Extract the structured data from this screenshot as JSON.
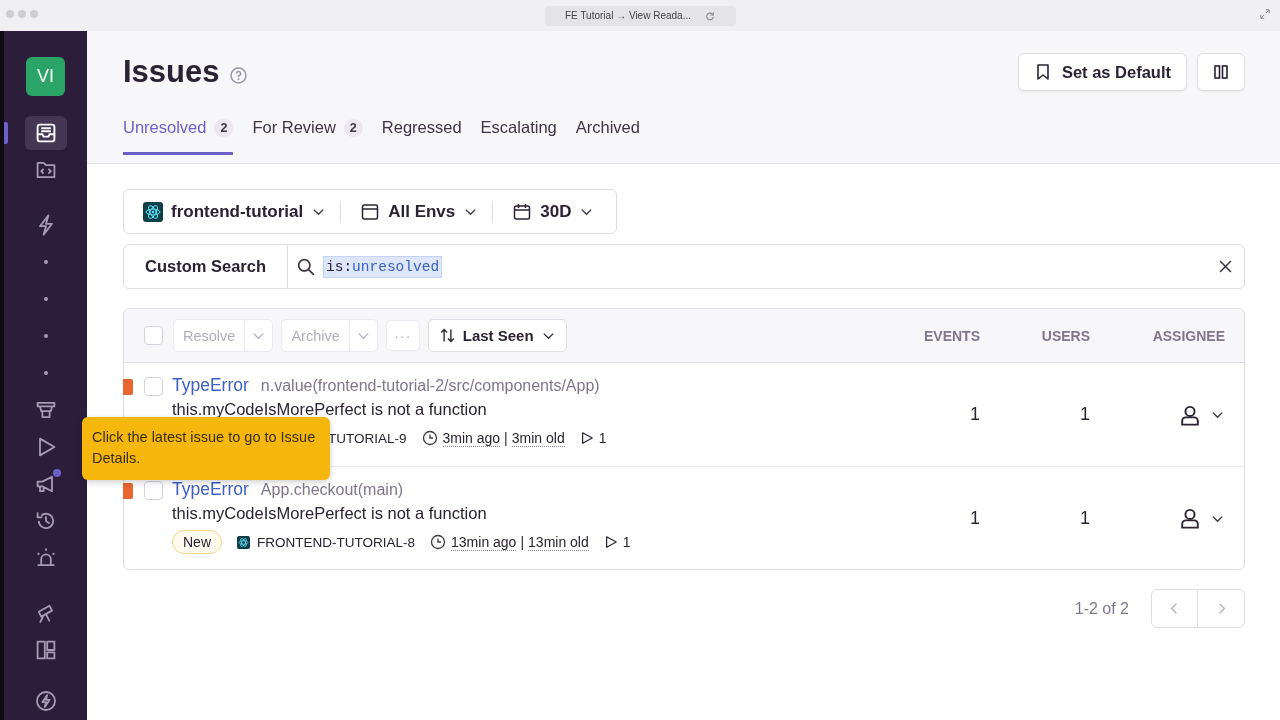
{
  "browser": {
    "title": "FE Tutorial → View Reada..."
  },
  "sidebar": {
    "avatar": "VI",
    "items": [
      {
        "kind": "icon",
        "selected": true,
        "notification": false
      },
      {
        "kind": "icon",
        "selected": false,
        "notification": false
      },
      {
        "kind": "icon",
        "selected": false,
        "notification": false
      },
      {
        "kind": "dot",
        "selected": false,
        "notification": false
      },
      {
        "kind": "dot",
        "selected": false,
        "notification": false
      },
      {
        "kind": "dot",
        "selected": false,
        "notification": false
      },
      {
        "kind": "dot",
        "selected": false,
        "notification": false
      },
      {
        "kind": "icon",
        "selected": false,
        "notification": false
      },
      {
        "kind": "icon",
        "selected": false,
        "notification": false
      },
      {
        "kind": "icon",
        "selected": false,
        "notification": true
      },
      {
        "kind": "icon",
        "selected": false,
        "notification": false
      },
      {
        "kind": "icon",
        "selected": false,
        "notification": false
      },
      {
        "kind": "icon",
        "selected": false,
        "notification": false
      },
      {
        "kind": "icon",
        "selected": false,
        "notification": false
      },
      {
        "kind": "icon",
        "selected": false,
        "notification": false
      }
    ]
  },
  "page": {
    "title": "Issues",
    "buttons": [
      "Set as Default"
    ]
  },
  "tabs": [
    {
      "label": "Unresolved",
      "count": "2",
      "selected": true
    },
    {
      "label": "For Review",
      "count": "2",
      "selected": false
    },
    {
      "label": "Regressed",
      "selected": false
    },
    {
      "label": "Escalating",
      "selected": false
    },
    {
      "label": "Archived",
      "selected": false
    }
  ],
  "filters": {
    "project": "frontend-tutorial",
    "environment": "All Envs",
    "period": "30D"
  },
  "search": {
    "label": "Custom Search",
    "key": "is:",
    "value": "unresolved"
  },
  "table": {
    "select_all": false,
    "actions": [
      "Resolve",
      "Archive"
    ],
    "more": "···",
    "sort": "Last Seen",
    "columns": [
      "EVENTS",
      "USERS",
      "ASSIGNEE"
    ],
    "rows": [
      {
        "type": "TypeError",
        "location": "n.value(frontend-tutorial-2/src/components/App)",
        "message": "this.myCodeIsMorePerfect is not a function",
        "checked": false,
        "under_tooltip": true,
        "short_id": "TUTORIAL-9",
        "last_seen": "3min ago",
        "separator": "|",
        "age": "3min old",
        "replays": "1",
        "events": "1",
        "users": "1"
      },
      {
        "type": "TypeError",
        "location": "App.checkout(main)",
        "message": "this.myCodeIsMorePerfect is not a function",
        "checked": false,
        "under_tooltip": false,
        "badge": "New",
        "short_id": "FRONTEND-TUTORIAL-8",
        "last_seen": "13min ago",
        "separator": "|",
        "age": "13min old",
        "replays": "1",
        "events": "1",
        "users": "1"
      }
    ]
  },
  "pagination": {
    "summary": "1-2 of 2"
  },
  "tooltip": {
    "text": "Click the latest issue to go to Issue Details."
  }
}
